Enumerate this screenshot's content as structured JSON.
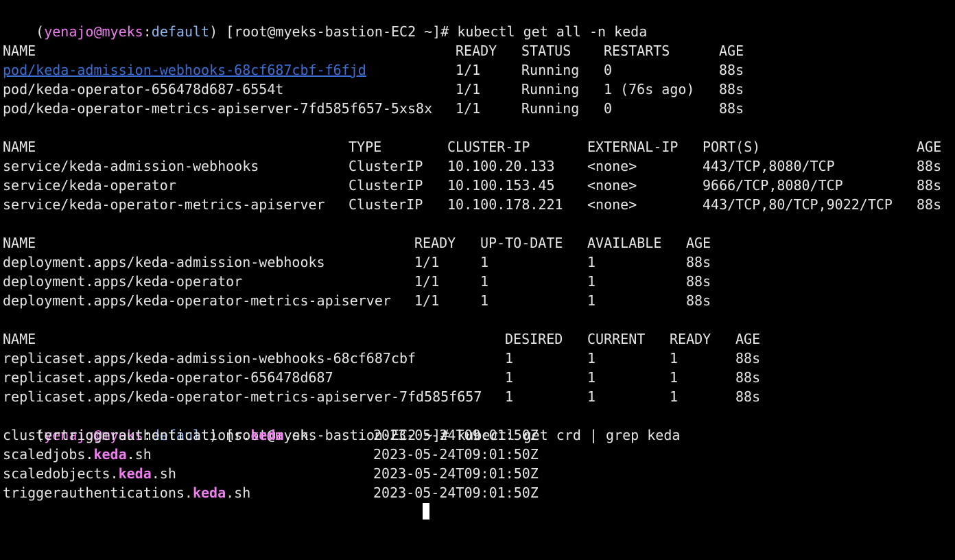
{
  "colors": {
    "prompt_user": "#f07ef0",
    "prompt_ns": "#8fb8f0",
    "link": "#3b6fd6",
    "grep_match": "#f07ef0"
  },
  "prompt": {
    "open": "(",
    "user": "yenajo",
    "at": "@",
    "host": "myeks",
    "colon": ":",
    "namespace": "default",
    "rest": ") [root@myeks-bastion-EC2 ~]# "
  },
  "commands": {
    "first": "kubectl get all -n keda",
    "second": "kubectl get crd | grep keda"
  },
  "pods": {
    "headers": [
      "NAME",
      "READY",
      "STATUS",
      "RESTARTS",
      "AGE"
    ],
    "rows": [
      [
        "pod/keda-admission-webhooks-68cf687cbf-f6fjd",
        "1/1",
        "Running",
        "0",
        "88s"
      ],
      [
        "pod/keda-operator-656478d687-6554t",
        "1/1",
        "Running",
        "1 (76s ago)",
        "88s"
      ],
      [
        "pod/keda-operator-metrics-apiserver-7fd585f657-5xs8x",
        "1/1",
        "Running",
        "0",
        "88s"
      ]
    ]
  },
  "services": {
    "headers": [
      "NAME",
      "TYPE",
      "CLUSTER-IP",
      "EXTERNAL-IP",
      "PORT(S)",
      "AGE"
    ],
    "rows": [
      [
        "service/keda-admission-webhooks",
        "ClusterIP",
        "10.100.20.133",
        "<none>",
        "443/TCP,8080/TCP",
        "88s"
      ],
      [
        "service/keda-operator",
        "ClusterIP",
        "10.100.153.45",
        "<none>",
        "9666/TCP,8080/TCP",
        "88s"
      ],
      [
        "service/keda-operator-metrics-apiserver",
        "ClusterIP",
        "10.100.178.221",
        "<none>",
        "443/TCP,80/TCP,9022/TCP",
        "88s"
      ]
    ]
  },
  "deployments": {
    "headers": [
      "NAME",
      "READY",
      "UP-TO-DATE",
      "AVAILABLE",
      "AGE"
    ],
    "rows": [
      [
        "deployment.apps/keda-admission-webhooks",
        "1/1",
        "1",
        "1",
        "88s"
      ],
      [
        "deployment.apps/keda-operator",
        "1/1",
        "1",
        "1",
        "88s"
      ],
      [
        "deployment.apps/keda-operator-metrics-apiserver",
        "1/1",
        "1",
        "1",
        "88s"
      ]
    ]
  },
  "replicasets": {
    "headers": [
      "NAME",
      "DESIRED",
      "CURRENT",
      "READY",
      "AGE"
    ],
    "rows": [
      [
        "replicaset.apps/keda-admission-webhooks-68cf687cbf",
        "1",
        "1",
        "1",
        "88s"
      ],
      [
        "replicaset.apps/keda-operator-656478d687",
        "1",
        "1",
        "1",
        "88s"
      ],
      [
        "replicaset.apps/keda-operator-metrics-apiserver-7fd585f657",
        "1",
        "1",
        "1",
        "88s"
      ]
    ]
  },
  "crds": {
    "match": "keda",
    "rows": [
      {
        "prefix": "clustertriggerauthentications.",
        "suffix": ".sh",
        "created": "2023-05-24T09:01:50Z"
      },
      {
        "prefix": "scaledjobs.",
        "suffix": ".sh",
        "created": "2023-05-24T09:01:50Z"
      },
      {
        "prefix": "scaledobjects.",
        "suffix": ".sh",
        "created": "2023-05-24T09:01:50Z"
      },
      {
        "prefix": "triggerauthentications.",
        "suffix": ".sh",
        "created": "2023-05-24T09:01:50Z"
      }
    ]
  }
}
